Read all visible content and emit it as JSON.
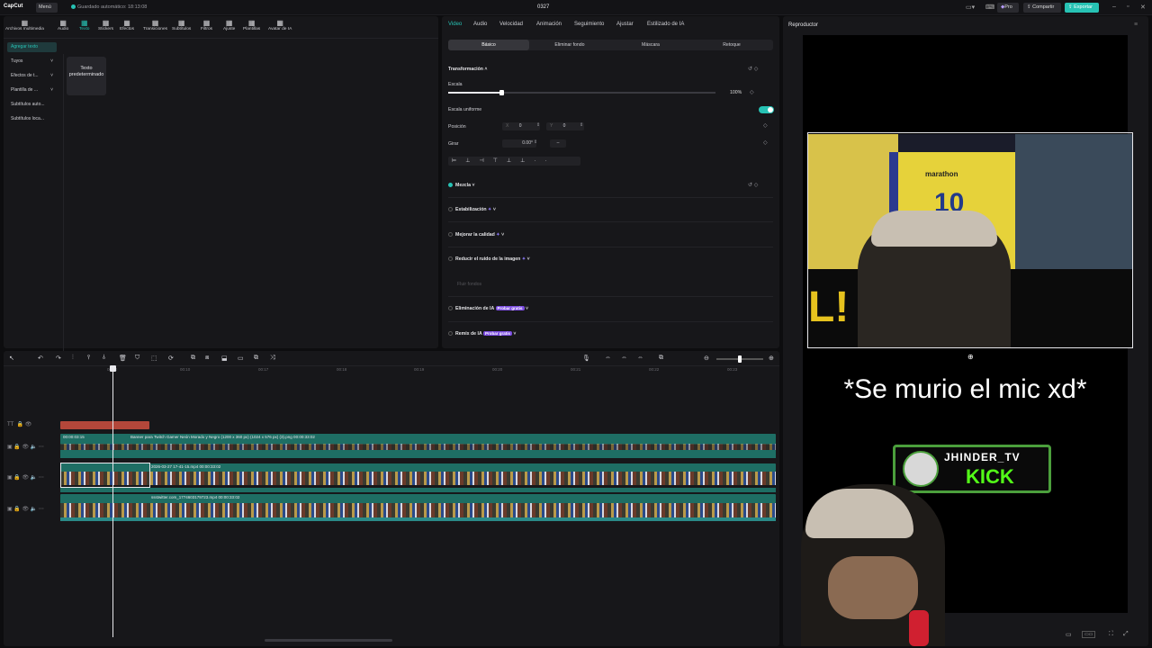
{
  "titlebar": {
    "logo": "CapCut",
    "menu": "Menú",
    "saved": "Guardado automático: 18:13:08",
    "project": "0327",
    "pro": "Pro",
    "share": "Compartir",
    "export": "Exportar"
  },
  "toolbar": [
    "Archivos multimedia",
    "Audio",
    "Texto",
    "Stickers",
    "Efectos",
    "Transiciones",
    "Subtítulos",
    "Filtros",
    "Ajuste",
    "Plantillas",
    "Avatar de IA"
  ],
  "toolbar_icons": [
    "media-icon",
    "audio-icon",
    "text-icon",
    "sticker-icon",
    "effects-icon",
    "transition-icon",
    "subtitle-icon",
    "filter-icon",
    "adjust-icon",
    "template-icon",
    "avatar-icon"
  ],
  "left_side": [
    "Agregar texto",
    "Tuyos",
    "Efectos de t...",
    "Plantilla de ...",
    "Subtítulos auto...",
    "Subtítulos loca..."
  ],
  "text_default": "Texto predeterminado",
  "props": {
    "tabs": [
      "Video",
      "Audio",
      "Velocidad",
      "Animación",
      "Seguimiento",
      "Ajustar",
      "Estilizado de IA"
    ],
    "subtabs": [
      "Básico",
      "Eliminar fondo",
      "Máscara",
      "Retoque"
    ],
    "transform": "Transformación",
    "scale": "Escala",
    "scale_value": "100%",
    "uniform": "Escala uniforme",
    "position": "Posición",
    "pos_x_label": "X",
    "pos_x": "0",
    "pos_y_label": "Y",
    "pos_y": "0",
    "rotate": "Girar",
    "rotate_value": "0.00°",
    "blend": "Mezcla",
    "stabilize": "Estabilización",
    "enhance": "Mejorar la calidad",
    "denoise": "Reducir el ruido de la imagen",
    "flicker": "Fluir fondos",
    "ai_remove": "Eliminación de IA",
    "ai_remix": "Remix de IA",
    "try_free": "Probar gratis"
  },
  "player": {
    "title": "Reproductor",
    "overlay_text": "*Se murio el mic xd*",
    "channel": "JHINDER_TV",
    "kick": "KICK",
    "jersey": "10",
    "brand": "marathon"
  },
  "timeline": {
    "ruler": [
      "00:00",
      "00:10",
      "00:17",
      "00:18",
      "00:19",
      "00:20",
      "00:21",
      "00:22",
      "00:23"
    ],
    "clips": [
      {
        "name": "Banner para Twitch Gamer Neón Morado y Negro (1200 x 360 px) (1024 x 576 px) (3).png  00:00:33:02",
        "lead": "00:00:03:15"
      },
      {
        "name": "2026-03-27 17-41-15.mp4  00:00:33:02"
      },
      {
        "name": "ssstwitter.com_1774603179723.mp4  00:00:33:02"
      }
    ]
  }
}
